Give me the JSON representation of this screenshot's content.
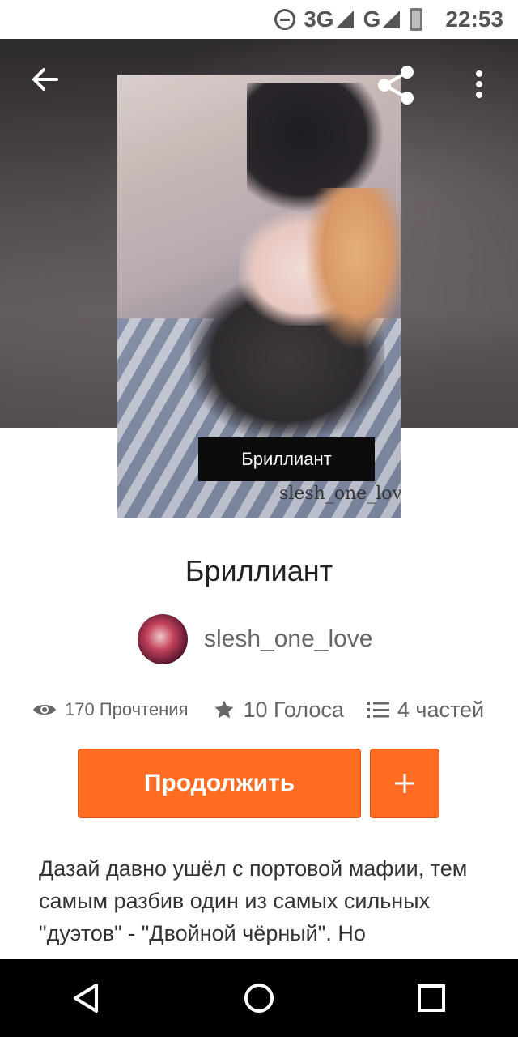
{
  "status_bar": {
    "network_3g": "3G",
    "network_g": "G",
    "time": "22:53"
  },
  "header": {
    "back_icon": "arrow-left-icon",
    "share_icon": "share-icon",
    "more_icon": "more-vertical-icon"
  },
  "cover": {
    "label": "Бриллиант",
    "watermark": "slesh_one_love"
  },
  "story": {
    "title": "Бриллиант",
    "author": "slesh_one_love",
    "stats": {
      "reads": "170 Прочтения",
      "votes": "10 Голоса",
      "parts": "4 частей"
    },
    "continue_label": "Продолжить",
    "add_label": "+",
    "description": "Дазай давно ушёл с портовой мафии, тем самым разбив один из самых сильных \"дуэтов\" - \"Двойной чёрный\". Но"
  },
  "colors": {
    "accent": "#ff6c22"
  },
  "nav": {
    "back_icon": "triangle-back-icon",
    "home_icon": "circle-home-icon",
    "recents_icon": "square-recents-icon"
  }
}
